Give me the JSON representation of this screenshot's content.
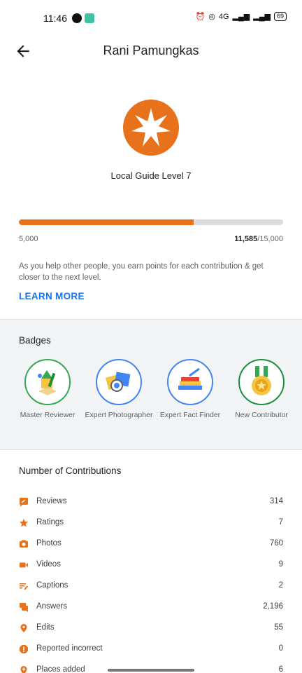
{
  "status_bar": {
    "time": "11:46",
    "battery": "69",
    "network": "4G"
  },
  "header": {
    "title": "Rani Pamungkas",
    "back_icon": "arrow-back-icon"
  },
  "level": {
    "label": "Local Guide Level 7",
    "accent": "#e8711c",
    "icon": "star-icon",
    "progress_fraction": 0.6625,
    "min_points": "5,000",
    "current_points": "11,585",
    "max_points": "/15,000"
  },
  "help": {
    "text": "As you help other people, you earn points for each contribution & get closer to the next level.",
    "learn_more": "LEARN MORE"
  },
  "badges": {
    "title": "Badges",
    "items": [
      {
        "label": "Master Reviewer",
        "icon": "master-reviewer-badge-icon",
        "ring": "#34a853"
      },
      {
        "label": "Expert Photographer",
        "icon": "expert-photographer-badge-icon",
        "ring": "#4285f4"
      },
      {
        "label": "Expert Fact Finder",
        "icon": "expert-fact-finder-badge-icon",
        "ring": "#4285f4"
      },
      {
        "label": "New Contributor",
        "icon": "new-contributor-badge-icon",
        "ring": "#34a853"
      }
    ]
  },
  "contributions": {
    "title": "Number of Contributions",
    "items": [
      {
        "label": "Reviews",
        "value": "314",
        "icon": "review-icon"
      },
      {
        "label": "Ratings",
        "value": "7",
        "icon": "star-icon"
      },
      {
        "label": "Photos",
        "value": "760",
        "icon": "camera-icon"
      },
      {
        "label": "Videos",
        "value": "9",
        "icon": "video-icon"
      },
      {
        "label": "Captions",
        "value": "2",
        "icon": "captions-icon"
      },
      {
        "label": "Answers",
        "value": "2,196",
        "icon": "answers-icon"
      },
      {
        "label": "Edits",
        "value": "55",
        "icon": "edit-pin-icon"
      },
      {
        "label": "Reported incorrect",
        "value": "0",
        "icon": "report-icon"
      },
      {
        "label": "Places added",
        "value": "6",
        "icon": "add-place-icon"
      }
    ]
  }
}
